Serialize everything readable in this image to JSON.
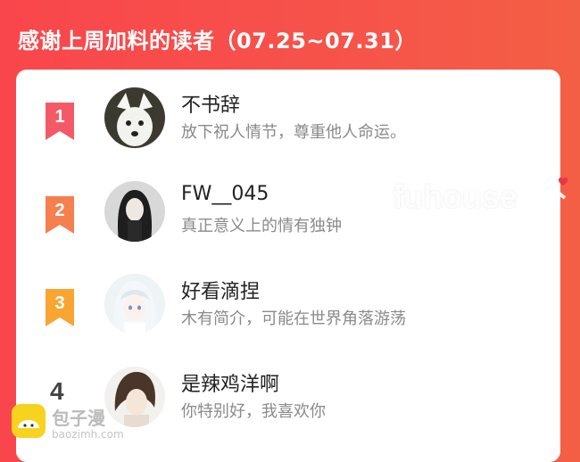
{
  "header": {
    "title": "感谢上周加料的读者（07.25~07.31）"
  },
  "readers": [
    {
      "rank": "1",
      "name": "不书辞",
      "motto": "放下祝人情节，尊重他人命运。",
      "badge_color": "#f45a66"
    },
    {
      "rank": "2",
      "name": "FW__045",
      "motto": "真正意义上的情有独钟",
      "badge_color": "#f67f4e"
    },
    {
      "rank": "3",
      "name": "好看滴捏",
      "motto": "木有简介，可能在世界角落游荡",
      "badge_color": "#f8a532"
    },
    {
      "rank": "4",
      "name": "是辣鸡洋啊",
      "motto": "你特别好，我喜欢你"
    }
  ],
  "watermark": {
    "text": "fuhouse"
  },
  "logo": {
    "text": "包子漫",
    "url": "baozimh.com"
  },
  "colors": {
    "background": "#f6504a",
    "card": "#ffffff"
  }
}
